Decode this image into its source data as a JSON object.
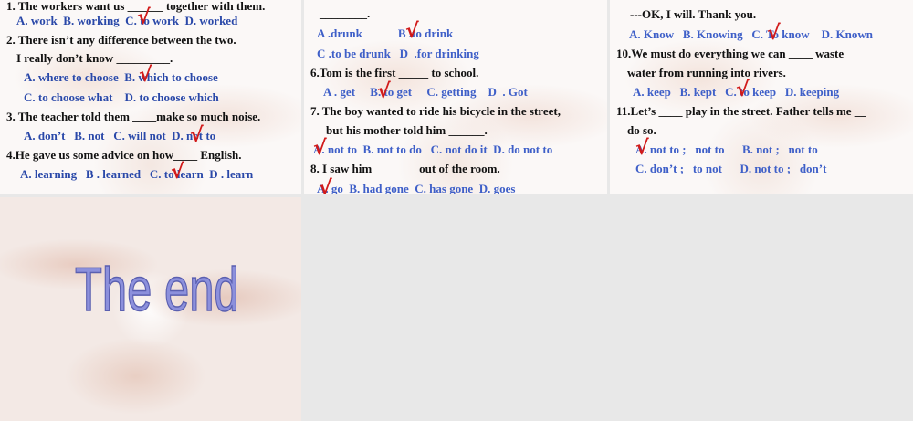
{
  "panel1": {
    "lines": [
      "1. The workers want us ______ together with them.",
      "A. work  B. working  C. to work  D. worked",
      "2. There isn’t any difference between the two.",
      "I really don’t know _________.",
      "A. where to choose  B. which to choose",
      "C. to choose what    D. to choose which",
      "3. The teacher told them ____make so much noise.",
      "A. don’t   B. not   C. will not  D. not to",
      "4.He gave us some advice on how____ English.",
      "A. learning   B . learned   C. to learn  D . learn"
    ]
  },
  "panel2": {
    "lines": [
      "________.",
      "A .drunk            B .to drink",
      "C .to be drunk   D  .for drinking",
      "6.Tom is the first _____ to school.",
      "A . get     B. to get     C. getting    D  . Got",
      "7. The boy wanted to ride his bicycle in the street,",
      "but his mother told him ______.",
      "A. not to  B. not to do   C. not do it  D. do not to",
      "8. I saw him _______ out of the room.",
      "A. go  B. had gone  C. has gone  D. goes"
    ]
  },
  "panel3": {
    "lines": [
      "---OK, I will. Thank you.",
      "A. Know   B. Knowing   C. To know    D. Known",
      "10.We must do everything we can ____ waste",
      "water from running into rivers.",
      "A. keep   B. kept   C. to keep   D. keeping",
      "11.Let’s ____ play in the street. Father tells me __",
      "do so.",
      "A. not to ;   not to      B. not ;   not to",
      "C. don’t ;   to not      D. not to ;   don’t"
    ]
  },
  "panel4": {
    "title": "The end"
  },
  "check_mark": "√",
  "colors": {
    "option_blue": "#3e5fc8",
    "check_red": "#d11a1a",
    "end_text": "#8c90dc"
  }
}
